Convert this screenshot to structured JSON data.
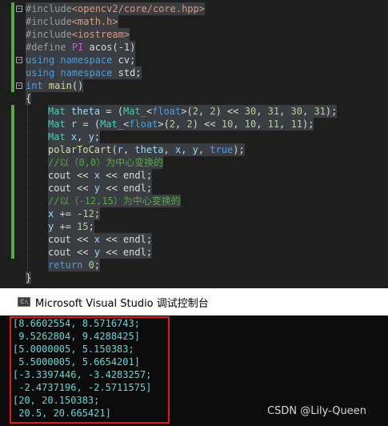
{
  "editor": {
    "lines": [
      "#include<opencv2/core/core.hpp>",
      "#include<math.h>",
      "#include<iostream>",
      "#define PI acos(-1)",
      "using namespace cv;",
      "using namespace std;",
      "int main()",
      "{",
      "Mat theta = (Mat_<float>(2, 2) << 30, 31, 30, 31);",
      "Mat r = (Mat_<float>(2, 2) << 10, 10, 11, 11);",
      "Mat x, y;",
      "polarToCart(r, theta, x, y, true);",
      "//以（0,0）为中心变换的",
      "cout << x << endl;",
      "cout << y << endl;",
      "//以（-12,15）为中心变换的",
      "x += -12;",
      "y += 15;",
      "cout << x << endl;",
      "cout << y << endl;",
      "return 0;",
      "}"
    ]
  },
  "console_window": {
    "title": "Microsoft Visual Studio 调试控制台",
    "icon": "console-app-icon",
    "output": [
      "[8.6602554, 8.5716743;",
      " 9.5262804, 9.4288425]",
      "[5.0000005, 5.150383;",
      " 5.5000005, 5.6654201]",
      "[-3.3397446, -3.4283257;",
      " -2.4737196, -2.5711575]",
      "[20, 20.150383;",
      " 20.5, 20.665421]"
    ]
  },
  "watermark": "CSDN @Lily-Queen",
  "colors": {
    "editor_bg": "#1e1e1e",
    "keyword": "#569cd6",
    "type": "#4ec9b0",
    "number": "#b5cea8",
    "comment": "#57a64a",
    "include_path": "#d69d85",
    "console_text": "#61d6d6",
    "change_marker": "#57a64a",
    "highlight_box": "#e0191f"
  }
}
